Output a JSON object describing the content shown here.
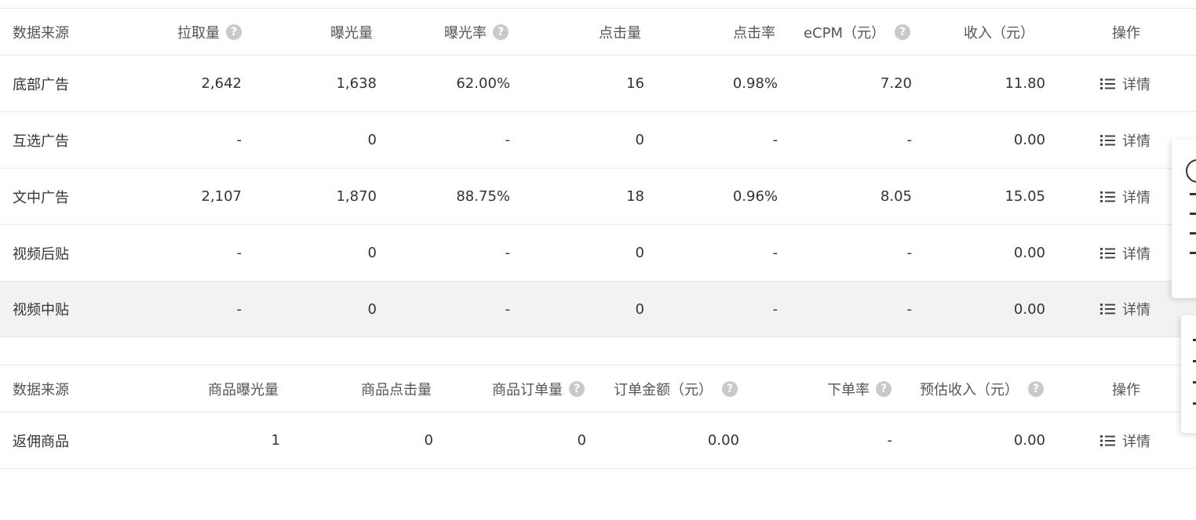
{
  "ads_table": {
    "headers": {
      "source": "数据来源",
      "pulls": "拉取量",
      "impressions": "曝光量",
      "impression_rate": "曝光率",
      "clicks": "点击量",
      "ctr": "点击率",
      "ecpm": "eCPM（元）",
      "revenue": "收入（元）",
      "action": "操作"
    },
    "rows": [
      {
        "source": "底部广告",
        "pulls": "2,642",
        "impressions": "1,638",
        "impression_rate": "62.00%",
        "clicks": "16",
        "ctr": "0.98%",
        "ecpm": "7.20",
        "revenue": "11.80",
        "action": "详情"
      },
      {
        "source": "互选广告",
        "pulls": "-",
        "impressions": "0",
        "impression_rate": "-",
        "clicks": "0",
        "ctr": "-",
        "ecpm": "-",
        "revenue": "0.00",
        "action": "详情"
      },
      {
        "source": "文中广告",
        "pulls": "2,107",
        "impressions": "1,870",
        "impression_rate": "88.75%",
        "clicks": "18",
        "ctr": "0.96%",
        "ecpm": "8.05",
        "revenue": "15.05",
        "action": "详情"
      },
      {
        "source": "视频后贴",
        "pulls": "-",
        "impressions": "0",
        "impression_rate": "-",
        "clicks": "0",
        "ctr": "-",
        "ecpm": "-",
        "revenue": "0.00",
        "action": "详情"
      },
      {
        "source": "视频中贴",
        "pulls": "-",
        "impressions": "0",
        "impression_rate": "-",
        "clicks": "0",
        "ctr": "-",
        "ecpm": "-",
        "revenue": "0.00",
        "action": "详情"
      }
    ]
  },
  "goods_table": {
    "headers": {
      "source": "数据来源",
      "product_impressions": "商品曝光量",
      "product_clicks": "商品点击量",
      "product_orders": "商品订单量",
      "order_amount": "订单金额（元）",
      "order_rate": "下单率",
      "estimated_revenue": "预估收入（元）",
      "action": "操作"
    },
    "rows": [
      {
        "source": "返佣商品",
        "product_impressions": "1",
        "product_clicks": "0",
        "product_orders": "0",
        "order_amount": "0.00",
        "order_rate": "-",
        "estimated_revenue": "0.00",
        "action": "详情"
      }
    ]
  },
  "icons": {
    "help": "help-circle-icon",
    "list": "list-icon"
  },
  "colors": {
    "border": "#e9e9e9",
    "highlight_row": "#f2f2f2",
    "help_icon": "#c9c9c9"
  }
}
